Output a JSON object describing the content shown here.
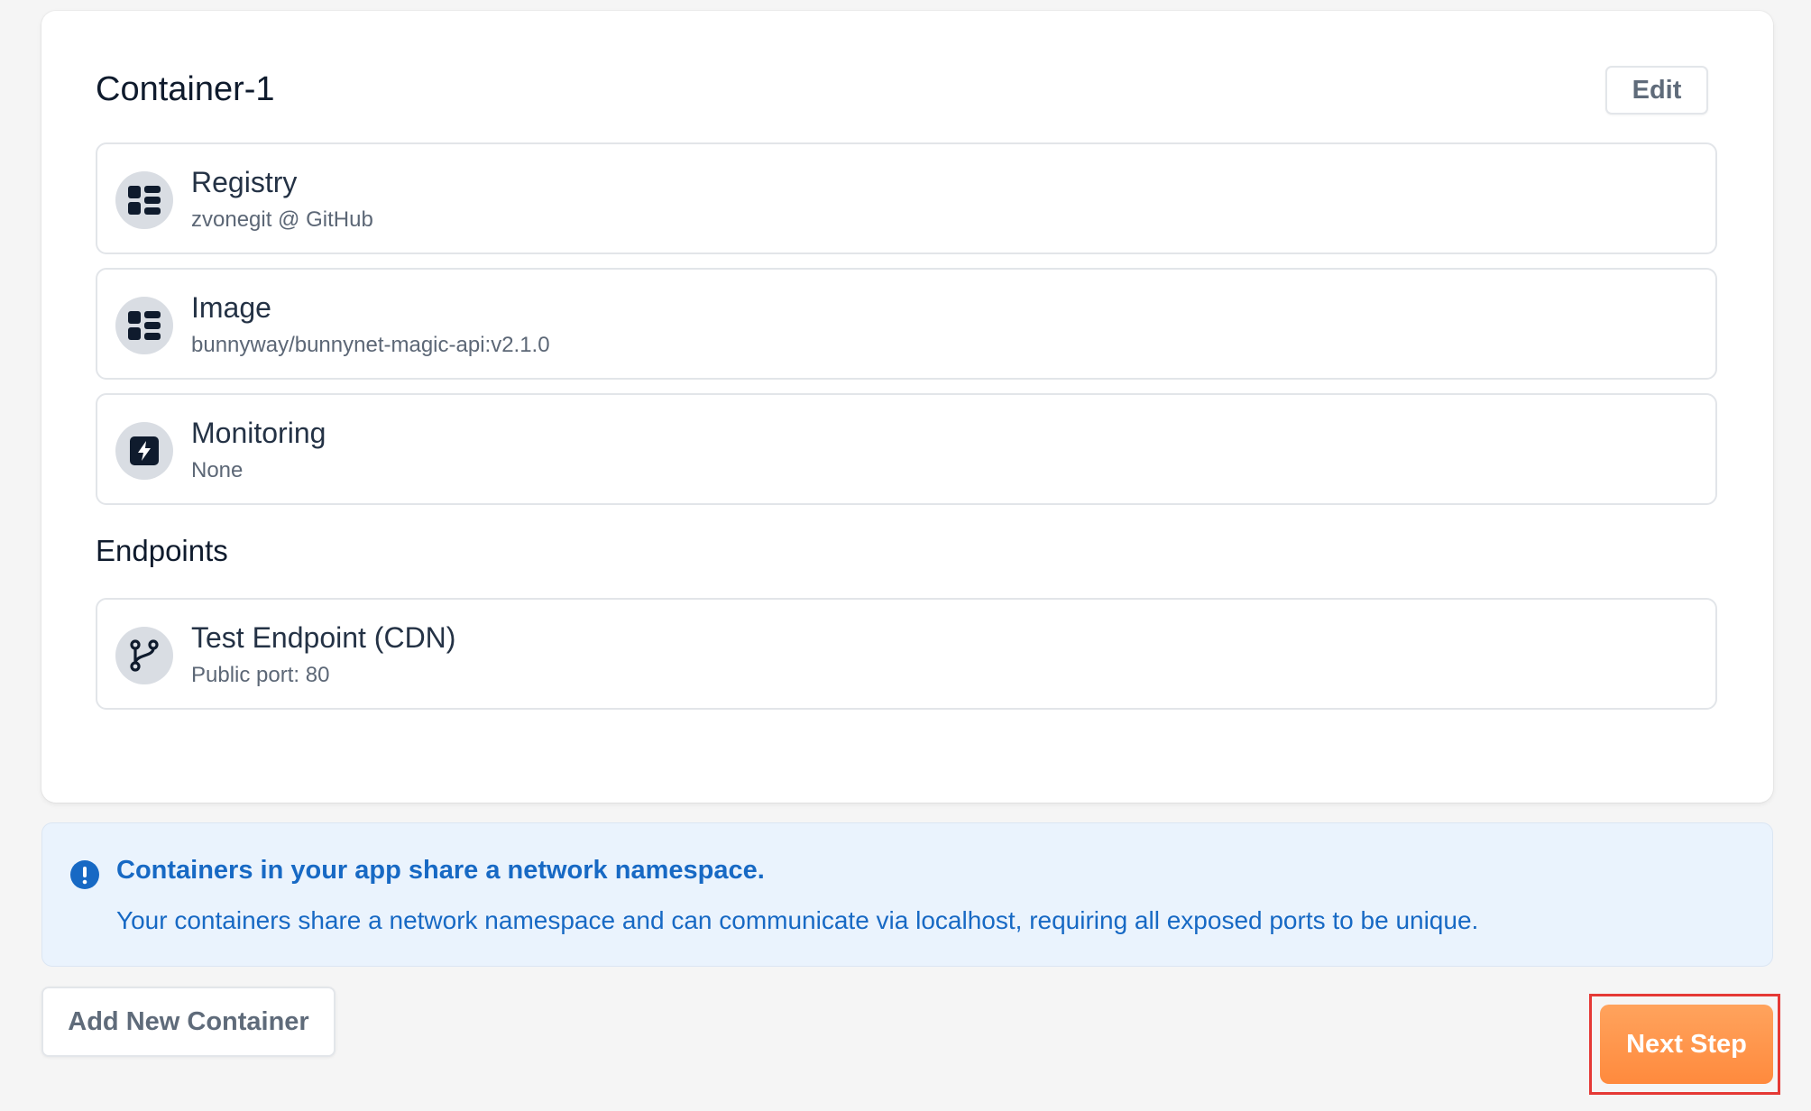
{
  "container": {
    "title": "Container-1",
    "edit_label": "Edit",
    "rows": [
      {
        "icon": "grid-icon",
        "title": "Registry",
        "subtitle": "zvonegit @ GitHub"
      },
      {
        "icon": "grid-icon",
        "title": "Image",
        "subtitle": "bunnyway/bunnynet-magic-api:v2.1.0"
      },
      {
        "icon": "lightning-icon",
        "title": "Monitoring",
        "subtitle": "None"
      }
    ],
    "endpoints_title": "Endpoints",
    "endpoints": [
      {
        "icon": "git-branch-icon",
        "title": "Test Endpoint (CDN)",
        "subtitle": "Public port: 80"
      }
    ]
  },
  "notice": {
    "icon": "info-icon",
    "title": "Containers in your app share a network namespace.",
    "text": "Your containers share a network namespace and can communicate via localhost, requiring all exposed ports to be unique."
  },
  "actions": {
    "add_container_label": "Add New Container",
    "next_step_label": "Next Step"
  },
  "colors": {
    "accent": "#ff8a3d",
    "info_blue": "#1769c4",
    "icon_dark": "#0f1b2d",
    "highlight": "#e53935"
  }
}
